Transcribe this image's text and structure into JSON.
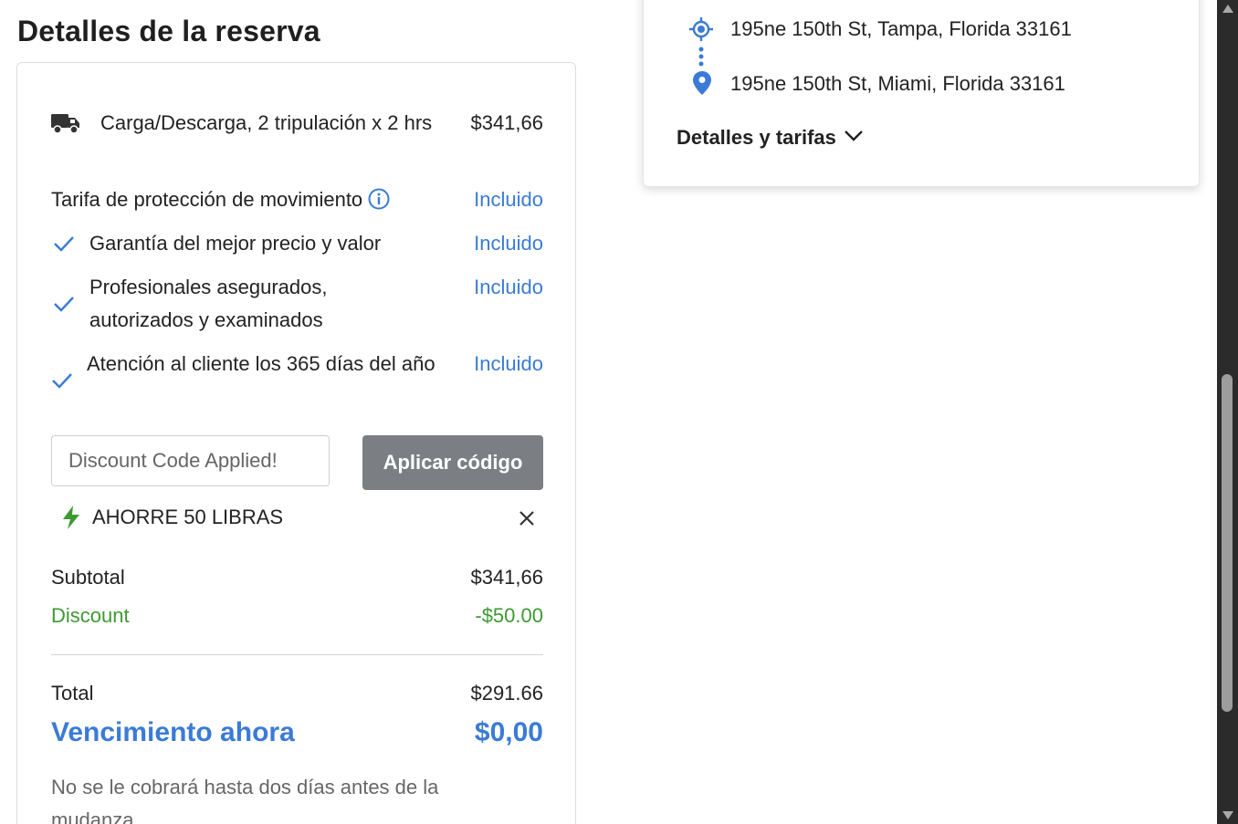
{
  "page": {
    "title": "Detalles de la reserva"
  },
  "booking": {
    "service": {
      "label": "Carga/Descarga, 2 tripulación x 2 hrs",
      "price": "$341,66"
    },
    "protection": {
      "label": "Tarifa de protección de movimiento",
      "value": "Incluido"
    },
    "features": [
      {
        "label": "Garantía del mejor precio y valor",
        "value": "Incluido"
      },
      {
        "label": "Profesionales asegurados, autorizados y examinados",
        "value": "Incluido"
      },
      {
        "label": "Atención al cliente los 365 días del año",
        "value": "Incluido"
      }
    ],
    "discount_input": {
      "placeholder": "Discount Code Applied!"
    },
    "apply_button": "Aplicar código",
    "promo": {
      "label": "AHORRE 50 LIBRAS"
    },
    "subtotal": {
      "label": "Subtotal",
      "value": "$341,66"
    },
    "discount": {
      "label": "Discount",
      "value": "-$50.00"
    },
    "total": {
      "label": "Total",
      "value": "$291.66"
    },
    "due_now": {
      "label": "Vencimiento ahora",
      "value": "$0,00"
    },
    "note": "No se le cobrará hasta dos días antes de la mudanza"
  },
  "route": {
    "origin": "195ne 150th St, Tampa, Florida 33161",
    "destination": "195ne 150th St, Miami, Florida 33161",
    "details_toggle": "Detalles y tarifas"
  },
  "colors": {
    "accent": "#3a7bd5",
    "discount_green": "#3d9a32",
    "button_gray": "#7b7f84"
  }
}
